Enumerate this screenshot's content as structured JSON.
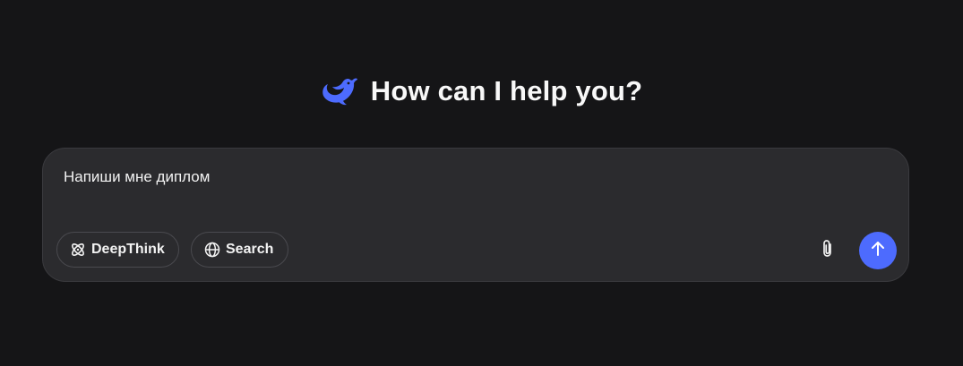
{
  "heading": {
    "logo_icon": "deepseek-whale-icon",
    "title": "How can I help you?"
  },
  "composer": {
    "input_value": "Напиши мне диплом",
    "chips": [
      {
        "label": "DeepThink",
        "icon": "atom-icon"
      },
      {
        "label": "Search",
        "icon": "globe-icon"
      }
    ],
    "attach_icon": "paperclip-icon",
    "send_icon": "arrow-up-icon"
  },
  "colors": {
    "background": "#151517",
    "composer_bg": "#2b2b2e",
    "accent": "#4d6bfe",
    "logo": "#4d6bfe"
  }
}
